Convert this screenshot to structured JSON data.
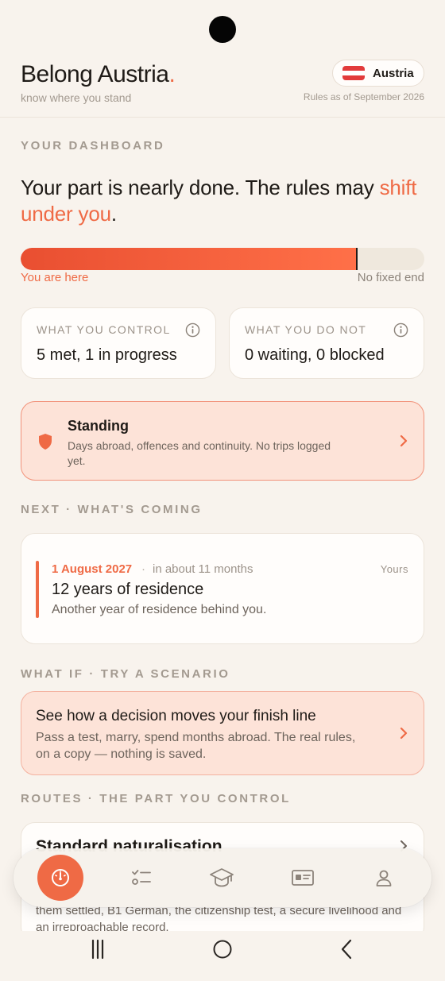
{
  "header": {
    "brand": "Belong Austria",
    "brand_dot": ".",
    "tagline": "know where you stand",
    "country": "Austria",
    "rules_date": "Rules as of September 2026"
  },
  "dashboard": {
    "section_label": "YOUR DASHBOARD",
    "headline_prefix": "Your part is nearly done. The rules may ",
    "headline_accent": "shift under you",
    "headline_suffix": ".",
    "progress_percent": 83,
    "progress_left_label": "You are here",
    "progress_right_label": "No fixed end"
  },
  "stats": [
    {
      "title": "WHAT YOU CONTROL",
      "value": "5 met, 1 in progress"
    },
    {
      "title": "WHAT YOU DO NOT",
      "value": "0 waiting, 0 blocked"
    }
  ],
  "standing": {
    "title": "Standing",
    "text": "Days abroad, offences and continuity. No trips logged yet."
  },
  "next": {
    "section_label": "NEXT · WHAT'S COMING",
    "date": "1 August 2027",
    "separator": "·",
    "relative": "in about 11 months",
    "owner": "Yours",
    "title": "12 years of residence",
    "text": "Another year of residence behind you."
  },
  "scenario": {
    "section_label": "WHAT IF · TRY A SCENARIO",
    "title": "See how a decision moves your finish line",
    "text": "Pass a test, marry, spend months abroad. The real rules, on a copy — nothing is saved."
  },
  "routes": {
    "section_label": "ROUTES · THE PART YOU CONTROL",
    "title": "Standard naturalisation",
    "text": "them settled, B1 German, the citizenship test, a secure livelihood and an irreproachable record."
  },
  "nav": {
    "items": [
      "dashboard-icon",
      "checklist-icon",
      "graduation-cap-icon",
      "id-card-icon",
      "profile-icon"
    ],
    "active_index": 0
  },
  "colors": {
    "accent": "#ef6a45",
    "background": "#f8f3ed",
    "card": "#fffdfb",
    "muted": "#a39a90"
  }
}
